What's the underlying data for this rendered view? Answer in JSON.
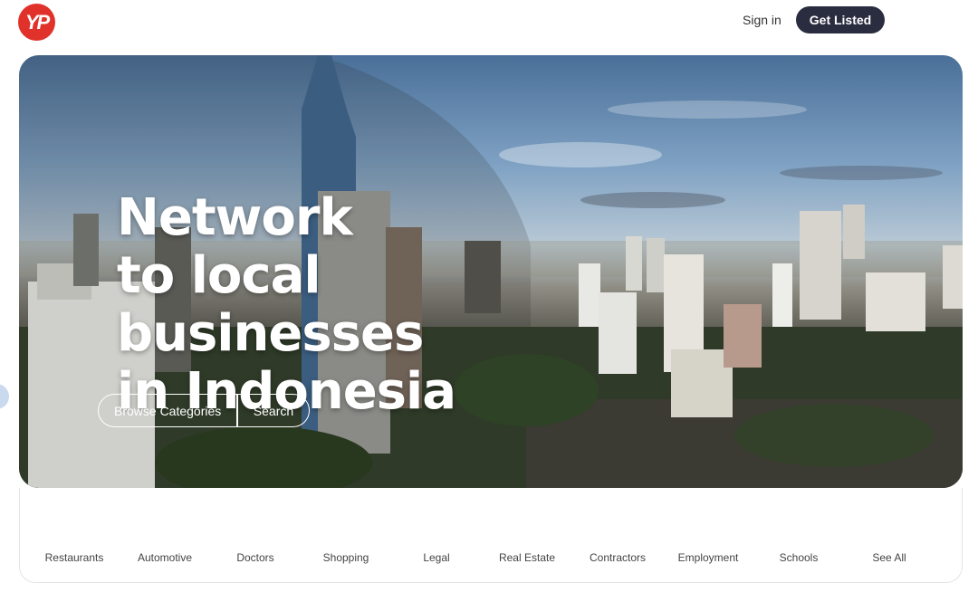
{
  "header": {
    "logo_text": "YP",
    "signin_label": "Sign in",
    "get_listed_label": "Get Listed"
  },
  "hero": {
    "headline_lines": [
      "Network",
      "to local",
      "businesses",
      "in Indonesia"
    ],
    "browse_label": "Browse Categories",
    "search_label": "Search"
  },
  "categories": [
    "Restaurants",
    "Automotive",
    "Doctors",
    "Shopping",
    "Legal",
    "Real Estate",
    "Contractors",
    "Employment",
    "Schools",
    "See All"
  ],
  "colors": {
    "brand_red": "#e0322b",
    "button_dark": "#2a2c3f"
  }
}
